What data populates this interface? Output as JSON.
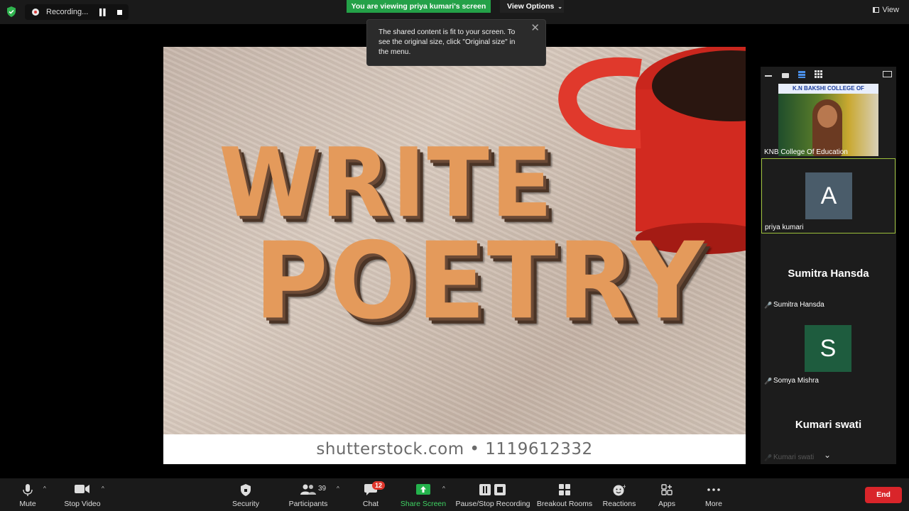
{
  "topbar": {
    "recording_label": "Recording...",
    "viewing_banner": "You are viewing priya kumari's screen",
    "view_options_label": "View Options",
    "view_label": "View"
  },
  "tooltip": {
    "text": "The shared content is fit to your screen. To see the original size, click \"Original size\" in the menu."
  },
  "shared_content": {
    "line1": "WRITE",
    "line2": "POETRY",
    "watermark": "shutterstock.com • 1119612332"
  },
  "participants_panel": {
    "tiles": [
      {
        "name": "KNB College Of Education",
        "video_banner": "K.N BAKSHI COLLEGE OF EDUCATION"
      },
      {
        "name": "priya kumari",
        "initial": "A",
        "initial_color": "#4a5c6a"
      },
      {
        "name": "Sumitra Hansda",
        "display_name": "Sumitra Hansda",
        "muted": true
      },
      {
        "name": "Somya Mishra",
        "initial": "S",
        "initial_color": "#1e5c3e",
        "muted": true
      },
      {
        "name": "Kumari swati",
        "display_name": "Kumari swati",
        "muted": true
      }
    ]
  },
  "toolbar": {
    "mute": "Mute",
    "stop_video": "Stop Video",
    "security": "Security",
    "participants": "Participants",
    "participants_count": "39",
    "chat": "Chat",
    "chat_badge": "12",
    "share_screen": "Share Screen",
    "pause_stop_recording": "Pause/Stop Recording",
    "breakout_rooms": "Breakout Rooms",
    "reactions": "Reactions",
    "apps": "Apps",
    "more": "More",
    "end": "End"
  },
  "colors": {
    "share_green": "#24a148",
    "end_red": "#d9252a",
    "active_border": "#9cbf3a"
  }
}
